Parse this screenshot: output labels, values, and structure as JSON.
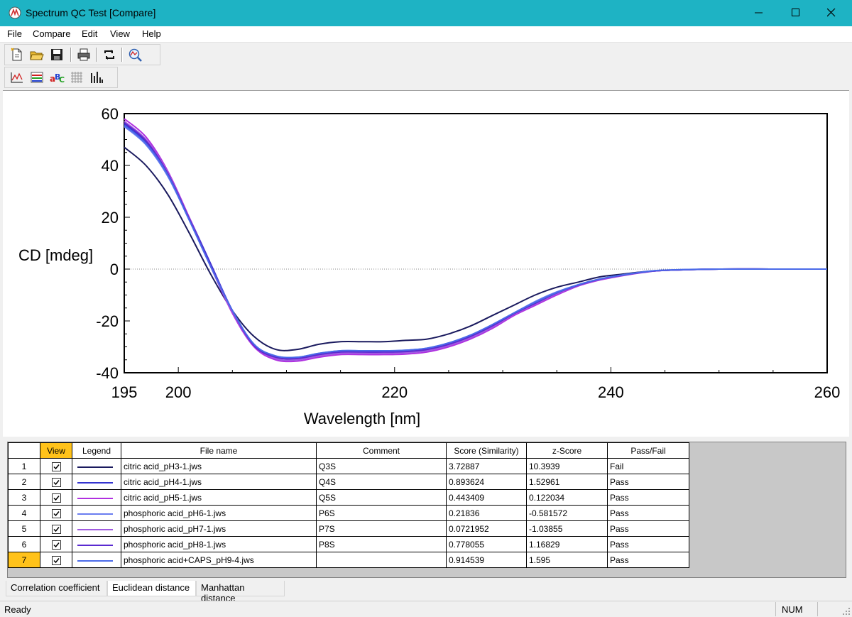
{
  "window": {
    "title": "Spectrum QC Test [Compare]"
  },
  "menu": [
    "File",
    "Compare",
    "Edit",
    "View",
    "Help"
  ],
  "toolbar1": [
    "new-file-icon",
    "open-folder-icon",
    "save-icon",
    "print-icon",
    "refresh-icon",
    "qc-search-icon"
  ],
  "toolbar2": [
    "spectrum-view-icon",
    "legend-view-icon",
    "abc-label-icon",
    "grid-view-icon",
    "bar-chart-icon"
  ],
  "chart_data": {
    "type": "line",
    "xlabel": "Wavelength [nm]",
    "ylabel": "CD [mdeg]",
    "xlim": [
      195,
      260
    ],
    "ylim": [
      -40,
      60
    ],
    "xticks": [
      195,
      200,
      220,
      240,
      260
    ],
    "yticks": [
      -40,
      -20,
      0,
      20,
      40,
      60
    ],
    "zero_line": true,
    "series": [
      {
        "color": "#1a1a5e",
        "x": [
          195,
          197,
          199,
          201,
          203,
          205,
          207,
          209,
          211,
          213,
          215,
          217,
          219,
          221,
          223,
          225,
          227,
          229,
          231,
          233,
          235,
          237,
          239,
          241,
          243,
          245,
          250,
          255,
          260
        ],
        "y": [
          47,
          40,
          29,
          14,
          -2,
          -16,
          -26,
          -31,
          -31,
          -29,
          -28,
          -28,
          -28,
          -27.5,
          -27,
          -25,
          -22,
          -18,
          -14,
          -10,
          -7,
          -5,
          -3,
          -2,
          -1,
          -0.5,
          0,
          0,
          0
        ]
      },
      {
        "color": "#3434d0",
        "x": [
          195,
          197,
          199,
          201,
          203,
          205,
          207,
          209,
          211,
          213,
          215,
          217,
          219,
          221,
          223,
          225,
          227,
          229,
          231,
          233,
          235,
          237,
          239,
          241,
          243,
          245,
          250,
          255,
          260
        ],
        "y": [
          56,
          49,
          37,
          20,
          2,
          -16,
          -29,
          -34,
          -34.5,
          -33,
          -32,
          -32,
          -32,
          -31.8,
          -31,
          -29,
          -26,
          -22,
          -17,
          -13,
          -9,
          -6,
          -4,
          -2.5,
          -1.2,
          -0.5,
          0,
          0,
          0
        ]
      },
      {
        "color": "#b030e0",
        "x": [
          195,
          197,
          199,
          201,
          203,
          205,
          207,
          209,
          211,
          213,
          215,
          217,
          219,
          221,
          223,
          225,
          227,
          229,
          231,
          233,
          235,
          237,
          239,
          241,
          243,
          245,
          250,
          255,
          260
        ],
        "y": [
          58,
          51,
          38,
          20,
          1,
          -17,
          -30,
          -35,
          -35.5,
          -34,
          -33,
          -33,
          -33,
          -32.8,
          -32,
          -30,
          -27,
          -23,
          -18,
          -14,
          -10,
          -6.5,
          -4.2,
          -2.6,
          -1.3,
          -0.5,
          0,
          0,
          0
        ]
      },
      {
        "color": "#6a7df0",
        "x": [
          195,
          197,
          199,
          201,
          203,
          205,
          207,
          209,
          211,
          213,
          215,
          217,
          219,
          221,
          223,
          225,
          227,
          229,
          231,
          233,
          235,
          237,
          239,
          241,
          243,
          245,
          250,
          255,
          260
        ],
        "y": [
          55,
          48,
          36,
          19,
          1,
          -16,
          -29,
          -33.5,
          -34,
          -32.5,
          -31.5,
          -31.5,
          -31.5,
          -31.3,
          -30.5,
          -28.5,
          -25.5,
          -21.5,
          -17,
          -12.5,
          -8.8,
          -6,
          -3.8,
          -2.3,
          -1.1,
          -0.4,
          0,
          0,
          0
        ]
      },
      {
        "color": "#a05ae0",
        "x": [
          195,
          197,
          199,
          201,
          203,
          205,
          207,
          209,
          211,
          213,
          215,
          217,
          219,
          221,
          223,
          225,
          227,
          229,
          231,
          233,
          235,
          237,
          239,
          241,
          243,
          245,
          250,
          255,
          260
        ],
        "y": [
          57,
          50,
          37.5,
          19.5,
          1,
          -16.5,
          -29.5,
          -34.5,
          -35,
          -33.5,
          -32.5,
          -32.5,
          -32.5,
          -32.3,
          -31.5,
          -29.5,
          -26.5,
          -22.5,
          -17.5,
          -13.5,
          -9.5,
          -6.3,
          -4,
          -2.5,
          -1.2,
          -0.5,
          0,
          0,
          0
        ]
      },
      {
        "color": "#5a2ad0",
        "x": [
          195,
          197,
          199,
          201,
          203,
          205,
          207,
          209,
          211,
          213,
          215,
          217,
          219,
          221,
          223,
          225,
          227,
          229,
          231,
          233,
          235,
          237,
          239,
          241,
          243,
          245,
          250,
          255,
          260
        ],
        "y": [
          56.5,
          49.5,
          37,
          19.5,
          1.5,
          -16,
          -29.5,
          -34,
          -34.5,
          -33,
          -32,
          -32,
          -32,
          -31.8,
          -31,
          -29,
          -26,
          -22,
          -17.3,
          -13.2,
          -9.2,
          -6.2,
          -3.9,
          -2.4,
          -1.2,
          -0.5,
          0,
          0,
          0
        ]
      },
      {
        "color": "#4a6ae8",
        "x": [
          195,
          197,
          199,
          201,
          203,
          205,
          207,
          209,
          211,
          213,
          215,
          217,
          219,
          221,
          223,
          225,
          227,
          229,
          231,
          233,
          235,
          237,
          239,
          241,
          243,
          245,
          250,
          255,
          260
        ],
        "y": [
          55.5,
          48.5,
          36.5,
          19,
          1,
          -16,
          -29,
          -33.5,
          -34,
          -32.5,
          -31.5,
          -31.5,
          -31.5,
          -31.3,
          -30.5,
          -28.5,
          -25.5,
          -21.5,
          -17,
          -12.8,
          -9,
          -6,
          -3.8,
          -2.3,
          -1.1,
          -0.4,
          0,
          0,
          0
        ]
      }
    ]
  },
  "table": {
    "headers": [
      "",
      "View",
      "Legend",
      "File name",
      "Comment",
      "Score (Similarity)",
      "z-Score",
      "Pass/Fail"
    ],
    "rows": [
      {
        "num": "1",
        "color": "#1a1a5e",
        "file": "citric acid_pH3-1.jws",
        "comment": "Q3S",
        "score": "3.72887",
        "z": "10.3939",
        "pf": "Fail"
      },
      {
        "num": "2",
        "color": "#3434d0",
        "file": "citric acid_pH4-1.jws",
        "comment": "Q4S",
        "score": "0.893624",
        "z": "1.52961",
        "pf": "Pass"
      },
      {
        "num": "3",
        "color": "#b030e0",
        "file": "citric acid_pH5-1.jws",
        "comment": "Q5S",
        "score": "0.443409",
        "z": "0.122034",
        "pf": "Pass"
      },
      {
        "num": "4",
        "color": "#6a7df0",
        "file": "phosphoric acid_pH6-1.jws",
        "comment": "P6S",
        "score": "0.21836",
        "z": "-0.581572",
        "pf": "Pass"
      },
      {
        "num": "5",
        "color": "#a05ae0",
        "file": "phosphoric acid_pH7-1.jws",
        "comment": "P7S",
        "score": "0.0721952",
        "z": "-1.03855",
        "pf": "Pass"
      },
      {
        "num": "6",
        "color": "#5a2ad0",
        "file": "phosphoric acid_pH8-1.jws",
        "comment": "P8S",
        "score": "0.778055",
        "z": "1.16829",
        "pf": "Pass"
      },
      {
        "num": "7",
        "color": "#4a6ae8",
        "file": "phosphoric acid+CAPS_pH9-4.jws",
        "comment": "",
        "score": "0.914539",
        "z": "1.595",
        "pf": "Pass"
      }
    ]
  },
  "tabs": [
    "Correlation coefficient",
    "Euclidean distance",
    "Manhattan distance"
  ],
  "status": {
    "text": "Ready",
    "num": "NUM"
  }
}
